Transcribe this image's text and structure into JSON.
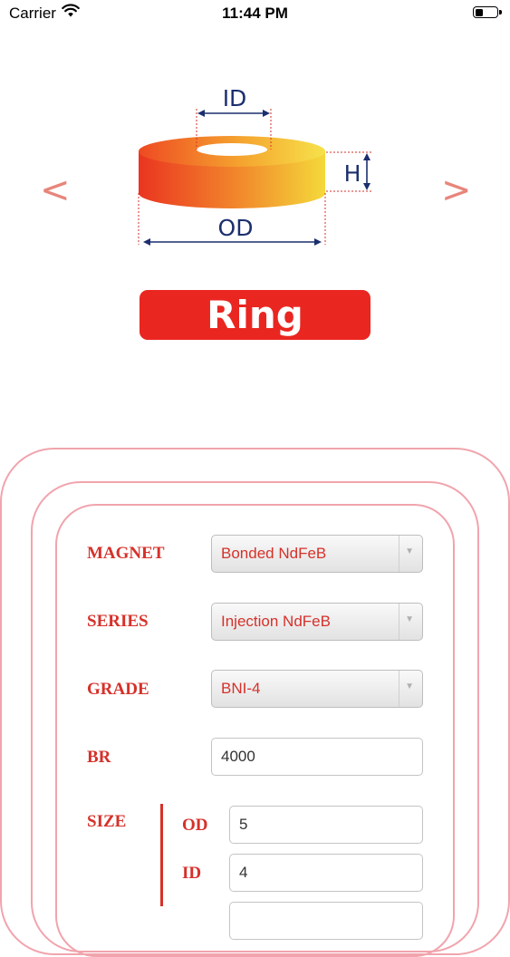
{
  "status_bar": {
    "carrier": "Carrier",
    "time": "11:44 PM",
    "battery_level": 0.4
  },
  "shape_selector": {
    "prev_icon": "chevron-left-icon",
    "next_icon": "chevron-right-icon",
    "prev_glyph": "<",
    "next_glyph": ">",
    "diagram": {
      "id_label": "ID",
      "od_label": "OD",
      "h_label": "H"
    },
    "shape_name": "Ring"
  },
  "form": {
    "magnet": {
      "label": "MAGNET",
      "value": "Bonded NdFeB"
    },
    "series": {
      "label": "SERIES",
      "value": "Injection NdFeB"
    },
    "grade": {
      "label": "GRADE",
      "value": "BNI-4"
    },
    "br": {
      "label": "BR",
      "value": "4000"
    },
    "size": {
      "label": "SIZE",
      "od": {
        "label": "OD",
        "value": "5"
      },
      "id": {
        "label": "ID",
        "value": "4"
      }
    }
  },
  "colors": {
    "accent_red": "#d6312a",
    "frame_pink": "#f1a4ad",
    "arrow": "#e8857a",
    "diagram_text": "#1b2f6e"
  }
}
